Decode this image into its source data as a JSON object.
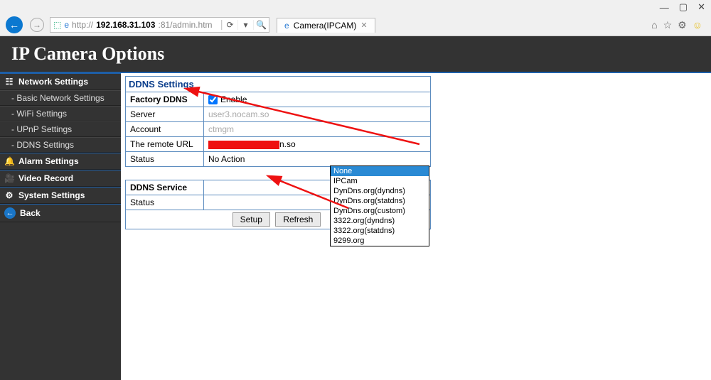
{
  "browser": {
    "url_prefix": "http://",
    "url_host": "192.168.31.103",
    "url_suffix": ":81/admin.htm",
    "tab_title": "Camera(IPCAM)",
    "win_min": "—",
    "win_max": "▢",
    "win_close": "✕"
  },
  "header": {
    "title": "IP Camera Options"
  },
  "sidebar": {
    "network": "Network Settings",
    "subs": [
      "Basic Network Settings",
      "WiFi Settings",
      "UPnP Settings",
      "DDNS Settings"
    ],
    "alarm": "Alarm Settings",
    "video": "Video Record",
    "system": "System Settings",
    "back": "Back"
  },
  "ddns": {
    "panel_title": "DDNS Settings",
    "rows": {
      "factory": "Factory DDNS",
      "enable": "Enable",
      "server": "Server",
      "server_val": "user3.nocam.so",
      "account": "Account",
      "account_val": "ctmgm",
      "remote": "The remote URL",
      "remote_suffix": "n.so",
      "status": "Status",
      "status_val": "No Action"
    },
    "service_label": "DDNS Service",
    "service_status": "Status",
    "options": [
      "None",
      "IPCam",
      "DynDns.org(dyndns)",
      "DynDns.org(statdns)",
      "DynDns.org(custom)",
      "3322.org(dyndns)",
      "3322.org(statdns)",
      "9299.org"
    ],
    "buttons": {
      "setup": "Setup",
      "refresh": "Refresh"
    }
  }
}
